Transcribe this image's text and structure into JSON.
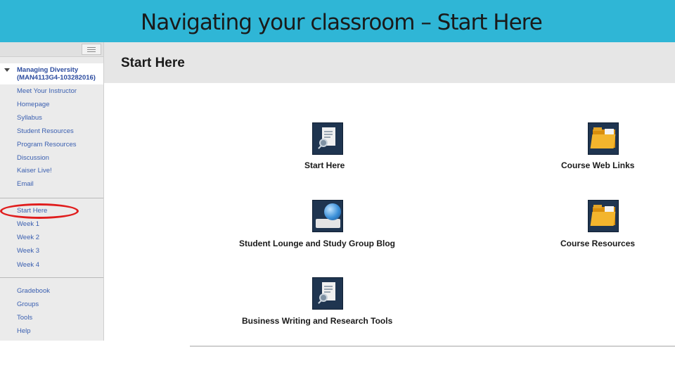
{
  "slide": {
    "title": "Navigating your classroom – Start Here"
  },
  "sidebar": {
    "course_title": "Managing Diversity (MAN4113G4-103282016)",
    "group1": [
      "Meet Your Instructor",
      "Homepage",
      "Syllabus",
      "Student Resources",
      "Program Resources",
      "Discussion",
      "Kaiser Live!",
      "Email"
    ],
    "group2": [
      "Start Here",
      "Week 1",
      "Week 2",
      "Week 3",
      "Week 4"
    ],
    "group3": [
      "Gradebook",
      "Groups",
      "Tools",
      "Help"
    ]
  },
  "main": {
    "page_title": "Start Here",
    "tiles": [
      {
        "label": "Start Here",
        "icon": "document-magnifier-icon"
      },
      {
        "label": "Course Web Links",
        "icon": "folder-icon"
      },
      {
        "label": "Student Lounge and Study Group Blog",
        "icon": "globe-book-icon"
      },
      {
        "label": "Course Resources",
        "icon": "folder-icon"
      },
      {
        "label": "Business Writing and Research Tools",
        "icon": "document-magnifier-icon"
      }
    ]
  },
  "colors": {
    "header_bar": "#2fb6d6",
    "menu_link": "#3a5fb0",
    "highlight_ellipse": "#e01d1d"
  }
}
